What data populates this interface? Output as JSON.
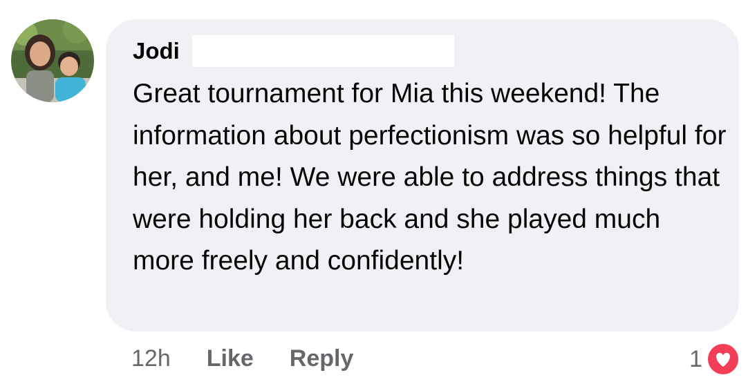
{
  "comment": {
    "author": "Jodi",
    "text": "Great tournament for Mia this weekend! The information about perfectionism was so helpful for her, and me! We were able to address things that were holding her back and she played much more freely and confidently!",
    "avatar_icon": "profile-photo-two-children",
    "bubble_color": "#eff1f4"
  },
  "actions": {
    "time": "12h",
    "like_label": "Like",
    "reply_label": "Reply"
  },
  "reactions": {
    "count": "1",
    "icon": "heart-icon",
    "color": "#f33e58"
  }
}
